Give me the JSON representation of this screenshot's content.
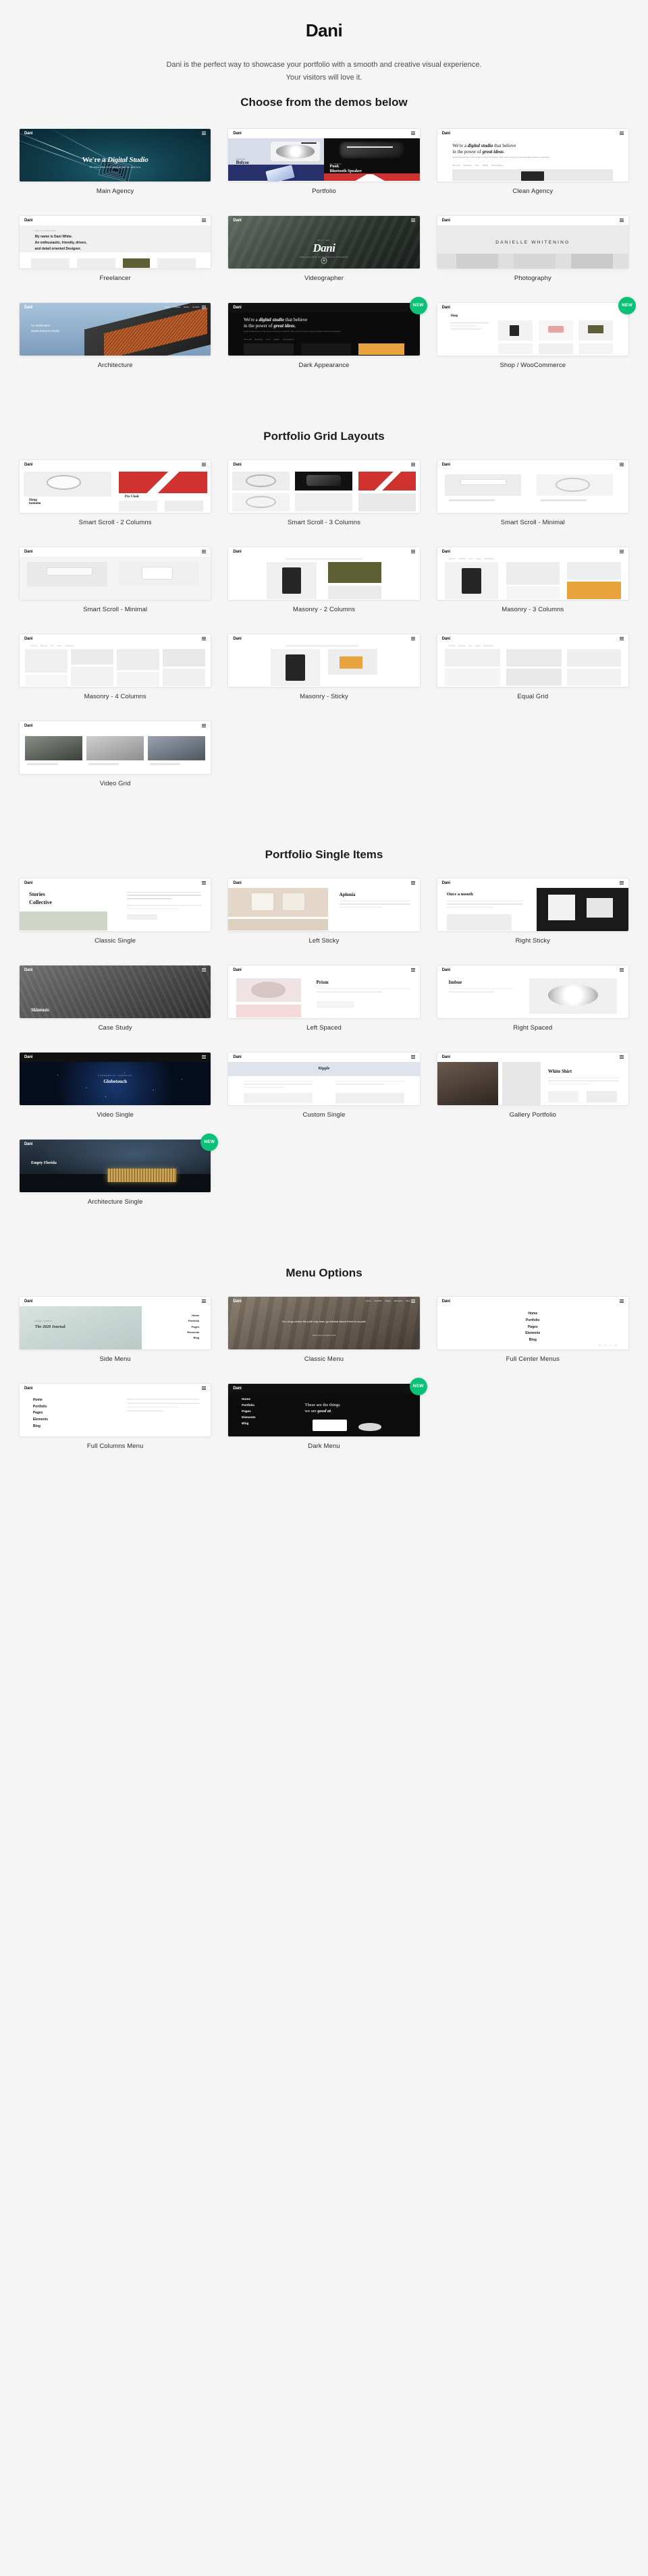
{
  "header": {
    "title": "Dani",
    "intro": "Dani is the perfect way to showcase your portfolio with a smooth and creative visual experience. Your visitors will love it.",
    "section_heading": "Choose from the demos below"
  },
  "badges": {
    "new_label": "NEW",
    "new_color": "#0bc177"
  },
  "brand_label": "Dani",
  "sections": [
    {
      "id": "demos",
      "heading": "",
      "cards": [
        {
          "label": "Main Agency",
          "art": "main-agency",
          "badge": null
        },
        {
          "label": "Portfolio",
          "art": "portfolio",
          "badge": null
        },
        {
          "label": "Clean Agency",
          "art": "clean-agency",
          "badge": null
        },
        {
          "label": "Freelancer",
          "art": "freelancer",
          "badge": null
        },
        {
          "label": "Videographer",
          "art": "videographer",
          "badge": null
        },
        {
          "label": "Photography",
          "art": "photography",
          "badge": null
        },
        {
          "label": "Architecture",
          "art": "architecture",
          "badge": null
        },
        {
          "label": "Dark Appearance",
          "art": "dark-appearance",
          "badge": "NEW"
        },
        {
          "label": "Shop / WooCommerce",
          "art": "shop",
          "badge": "NEW"
        }
      ]
    },
    {
      "id": "portfolio-grid",
      "heading": "Portfolio Grid Layouts",
      "cards": [
        {
          "label": "Smart Scroll - 2 Columns",
          "art": "ss-2col",
          "badge": null
        },
        {
          "label": "Smart Scroll - 3 Columns",
          "art": "ss-3col",
          "badge": null
        },
        {
          "label": "Smart Scroll - Minimal",
          "art": "ss-min-a",
          "badge": null
        },
        {
          "label": "Smart Scroll - Minimal",
          "art": "ss-min-b",
          "badge": null
        },
        {
          "label": "Masonry - 2 Columns",
          "art": "mas-2col",
          "badge": null
        },
        {
          "label": "Masonry - 3 Columns",
          "art": "mas-3col",
          "badge": null
        },
        {
          "label": "Masonry - 4 Columns",
          "art": "mas-4col",
          "badge": null
        },
        {
          "label": "Masonry - Sticky",
          "art": "mas-sticky",
          "badge": null
        },
        {
          "label": "Equal Grid",
          "art": "equal-grid",
          "badge": null
        },
        {
          "label": "Video Grid",
          "art": "video-grid",
          "badge": null
        }
      ]
    },
    {
      "id": "portfolio-single",
      "heading": "Portfolio Single Items",
      "cards": [
        {
          "label": "Classic Single",
          "art": "classic-single",
          "badge": null
        },
        {
          "label": "Left Sticky",
          "art": "left-sticky",
          "badge": null
        },
        {
          "label": "Right Sticky",
          "art": "right-sticky",
          "badge": null
        },
        {
          "label": "Case Study",
          "art": "case-study",
          "badge": null
        },
        {
          "label": "Left Spaced",
          "art": "left-spaced",
          "badge": null
        },
        {
          "label": "Right Spaced",
          "art": "right-spaced",
          "badge": null
        },
        {
          "label": "Video Single",
          "art": "video-single",
          "badge": null
        },
        {
          "label": "Custom Single",
          "art": "custom-single",
          "badge": null
        },
        {
          "label": "Gallery Portfolio",
          "art": "gallery-portfolio",
          "badge": null
        },
        {
          "label": "Architecture Single",
          "art": "arch-single",
          "badge": "NEW"
        }
      ]
    },
    {
      "id": "menu-options",
      "heading": "Menu Options",
      "cards": [
        {
          "label": "Side Menu",
          "art": "side-menu",
          "badge": null
        },
        {
          "label": "Classic Menu",
          "art": "classic-menu",
          "badge": null
        },
        {
          "label": "Full Center Menus",
          "art": "full-center",
          "badge": null
        },
        {
          "label": "Full Columns Menu",
          "art": "full-columns",
          "badge": null
        },
        {
          "label": "Dark Menu",
          "art": "dark-menu",
          "badge": "NEW"
        }
      ]
    }
  ],
  "art_text": {
    "main_agency_title_a": "We're a ",
    "main_agency_title_b": "Digital Studio",
    "main_agency_sub": "We know what we're good at, and we stick to it.",
    "portfolio_kicker": "SAMSUNG",
    "portfolio_name": "Belyse",
    "portfolio_kicker2": "SOL REPUBLIC",
    "portfolio_name2a": "Punk",
    "portfolio_name2b": "Bluetooth Speaker",
    "clean_line1a": "We're a ",
    "clean_line1b": "digital studio",
    "clean_line1c": " that believe",
    "clean_line2a": "in the power of ",
    "clean_line2b": "great ideas",
    "clean_body": "Great Products are not the result of a burst of creativity. They come from joy of experimentation and form exploration.",
    "clean_nav": [
      "Show all",
      "Branding",
      "Print",
      "Digital",
      "Photography"
    ],
    "freelancer_kicker": "HELLO EVERYONE",
    "freelancer_l1": "My name is Dani White.",
    "freelancer_l2": "An enthusiastic, friendly, driven,",
    "freelancer_l3": "and detail oriented Designer.",
    "video_script": "Dani",
    "video_kicker": "Hi! I am",
    "photography_title": "DANIELLE WHITENING",
    "architecture_l1": "An architecture",
    "architecture_l2": "Studio based in Dublin",
    "shop_title": "Shop",
    "menu_items": [
      "Home",
      "Portfolio",
      "Pages",
      "Elements",
      "Blog"
    ],
    "side_menu_kicker": "READ LATEST",
    "side_menu_title": "The 2020 Journal",
    "classic_menu_quote": "Do not go where the path may lead, go instead where there is no path",
    "classic_menu_sub": "Motion Key and Lighter Detail",
    "dark_menu_l1": "These are the things",
    "dark_menu_l2": "we are good at.",
    "gallery_title": "White Shirt",
    "custom_single_title": "Ripple",
    "case_study_title": "Skintosis",
    "video_single_title": "Globetouch",
    "video_single_kicker": "COMMERCIAL CAMPAIGN",
    "arch_single_title": "Empty Florida",
    "classic_single_l1": "Stories",
    "classic_single_l2": "Collective",
    "left_sticky_title": "Aplonia",
    "right_sticky_title": "Once a month",
    "right_spaced_title": "Imbue",
    "left_spaced_title": "Prism"
  }
}
